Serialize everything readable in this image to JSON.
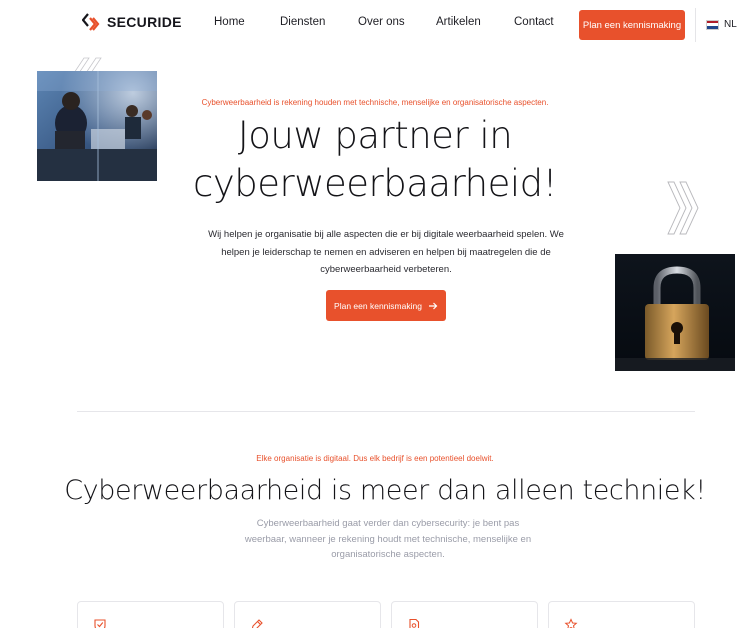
{
  "header": {
    "logo_text": "SECURIDE",
    "nav": [
      "Home",
      "Diensten",
      "Over ons",
      "Artikelen",
      "Contact"
    ],
    "cta_label": "Plan een kennismaking",
    "language": "NL"
  },
  "hero": {
    "eyebrow": "Cyberweerbaarheid is rekening houden met technische, menselijke en organisatorische aspecten.",
    "title_line1": "Jouw partner in",
    "title_line2": "cyberweerbaarheid!",
    "description": "Wij helpen je organisatie bij alle aspecten die er bij digitale weerbaarheid spelen. We helpen je leiderschap te nemen en adviseren en helpen bij maatregelen die de cyberweerbaarheid verbeteren.",
    "cta_label": "Plan een kennismaking"
  },
  "section": {
    "eyebrow": "Elke organisatie is digitaal. Dus elk bedrijf is een potentieel doelwit.",
    "title": "Cyberweerbaarheid is meer dan alleen techniek!",
    "description": "Cyberweerbaarheid gaat verder dan cybersecurity: je bent pas weerbaar, wanneer je rekening houdt met technische, menselijke en organisatorische aspecten."
  },
  "cards": [
    {
      "icon": "shield-check-icon"
    },
    {
      "icon": "pen-tool-icon"
    },
    {
      "icon": "file-search-icon"
    },
    {
      "icon": "star-icon"
    }
  ],
  "colors": {
    "accent": "#e8512c",
    "text": "#141418",
    "muted": "#9a9ca8"
  }
}
